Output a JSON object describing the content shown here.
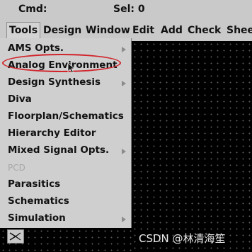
{
  "statusbar": {
    "cmd": "Cmd:",
    "sel": "Sel: 0"
  },
  "menubar": [
    "Tools",
    "Design",
    "Window",
    "Edit",
    "Add",
    "Check",
    "Shee"
  ],
  "tools_menu": [
    "AMS Opts.",
    "Analog Environment",
    "Design Synthesis",
    "Diva",
    "Floorplan/Schematics",
    "Hierarchy Editor",
    "Mixed Signal Opts.",
    "PCD",
    "Parasitics",
    "Schematics",
    "Simulation"
  ],
  "watermark": "CSDN @林清海笙",
  "colors": {
    "highlight_ring": "#d1232a",
    "canvas": "#000000",
    "menu_bg": "#cfcfcf"
  }
}
